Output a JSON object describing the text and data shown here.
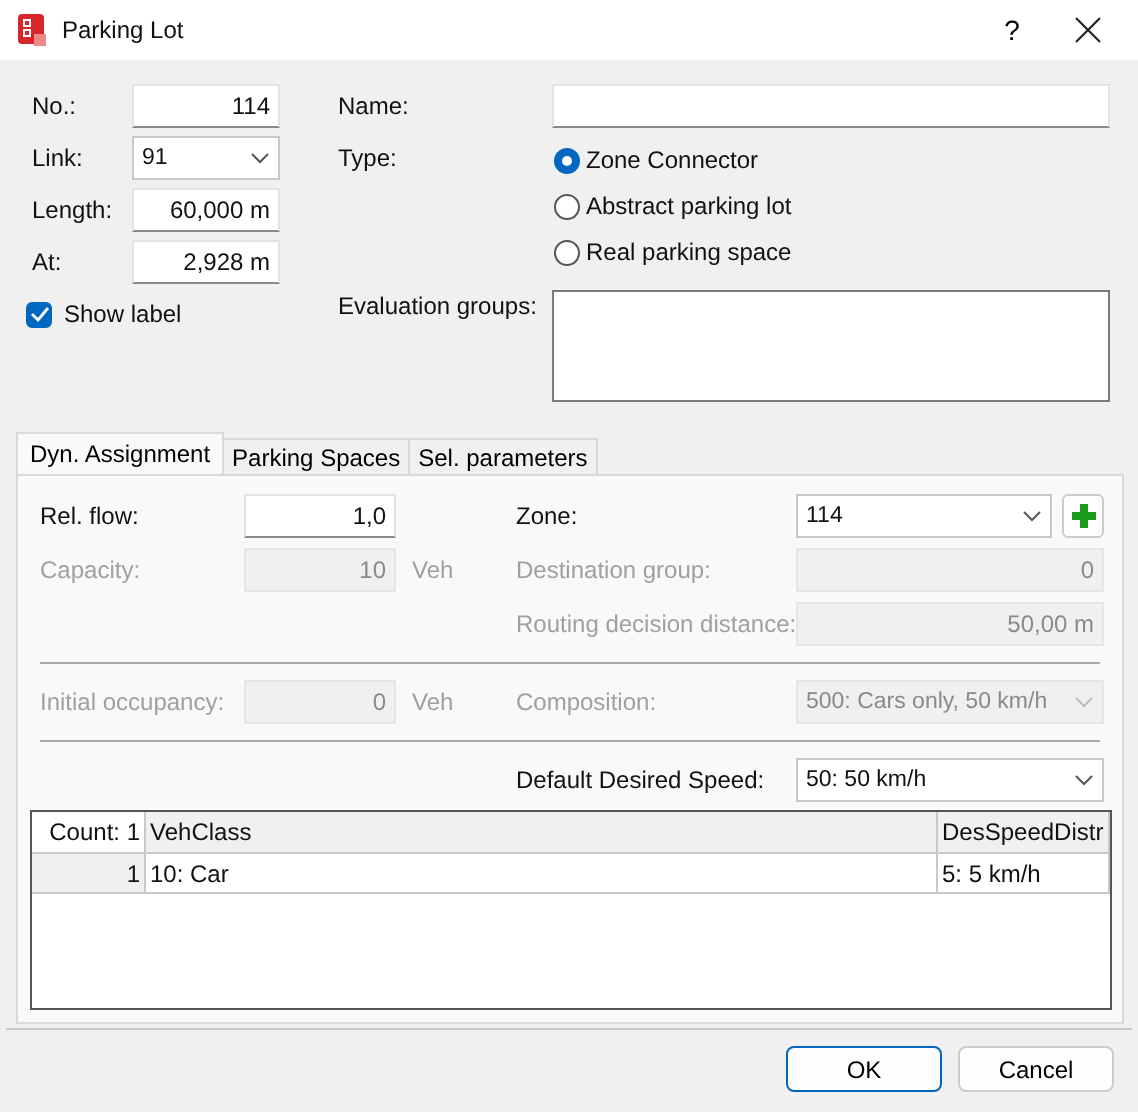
{
  "window": {
    "title": "Parking Lot",
    "help": "?"
  },
  "general": {
    "number": {
      "label": "No.:",
      "value": "114"
    },
    "link": {
      "label": "Link:",
      "value": "91"
    },
    "length": {
      "label": "Length:",
      "value": "60,000 m"
    },
    "at": {
      "label": "At:",
      "value": "2,928 m"
    },
    "show_label": {
      "label": "Show label",
      "checked": true
    },
    "name": {
      "label": "Name:"
    },
    "type": {
      "label": "Type:",
      "options": [
        {
          "label": "Zone Connector",
          "selected": true
        },
        {
          "label": "Abstract parking lot",
          "selected": false
        },
        {
          "label": "Real parking space",
          "selected": false
        }
      ]
    },
    "evaluation_groups": {
      "label": "Evaluation groups:"
    }
  },
  "tabs": [
    {
      "label": "Dyn. Assignment",
      "selected": true
    },
    {
      "label": "Parking Spaces",
      "selected": false
    },
    {
      "label": "Sel. parameters",
      "selected": false
    }
  ],
  "dyn_assignment": {
    "rel_flow": {
      "label": "Rel. flow:",
      "value": "1,0",
      "disabled": false
    },
    "zone": {
      "label": "Zone:",
      "value": "114",
      "disabled": false
    },
    "capacity": {
      "label": "Capacity:",
      "value": "10",
      "unit": "Veh",
      "disabled": true
    },
    "destination_group": {
      "label": "Destination group:",
      "value": "0",
      "disabled": true
    },
    "routing_decision_distance": {
      "label": "Routing decision distance:",
      "value": "50,00 m",
      "disabled": true
    },
    "initial_occupancy": {
      "label": "Initial occupancy:",
      "value": "0",
      "unit": "Veh",
      "disabled": true
    },
    "composition": {
      "label": "Composition:",
      "value": "500: Cars only, 50 km/h",
      "disabled": true
    },
    "default_desired_speed": {
      "label": "Default Desired Speed:",
      "value": "50: 50 km/h",
      "disabled": false
    },
    "table": {
      "columns": [
        "Count: 1",
        "VehClass",
        "DesSpeedDistr"
      ],
      "rows": [
        [
          "1",
          "10: Car",
          "5: 5 km/h"
        ]
      ]
    }
  },
  "buttons": [
    {
      "label": "OK",
      "default": true
    },
    {
      "label": "Cancel",
      "default": false
    }
  ]
}
